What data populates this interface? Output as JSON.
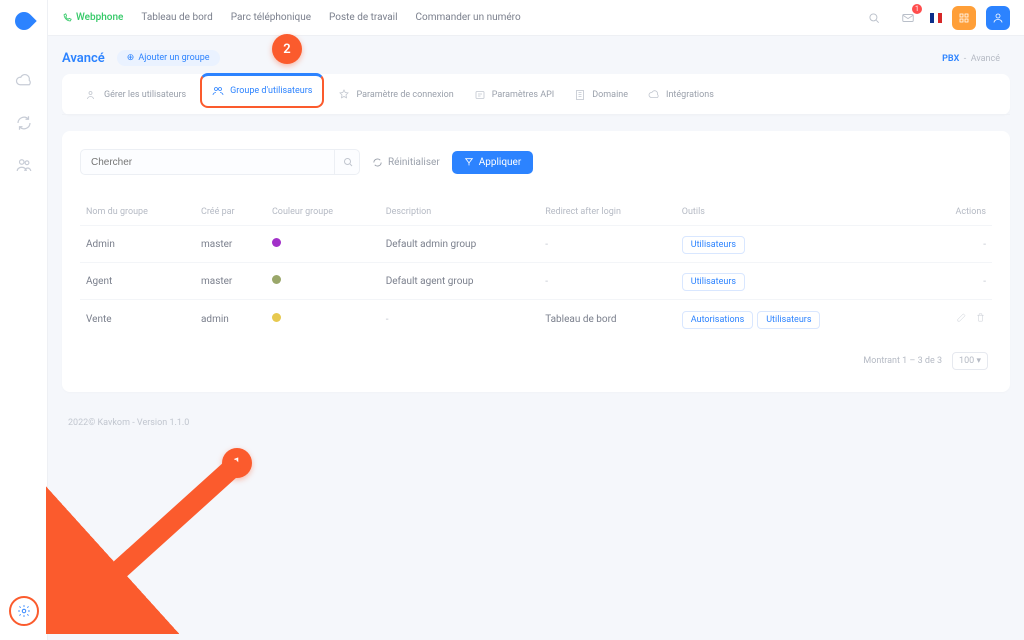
{
  "topnav": {
    "webphone": "Webphone",
    "items": [
      "Tableau de bord",
      "Parc téléphonique",
      "Poste de travail",
      "Commander un numéro"
    ],
    "notif_count": "1"
  },
  "page": {
    "title": "Avancé",
    "add_group": "Ajouter un groupe"
  },
  "breadcrumb": {
    "root": "PBX",
    "sep": "-",
    "current": "Avancé"
  },
  "tabs": {
    "manage_users": "Gérer les utilisateurs",
    "user_group": "Groupe d'utilisateurs",
    "login_param": "Paramètre de connexion",
    "api_params": "Paramètres API",
    "domain": "Domaine",
    "integrations": "Intégrations"
  },
  "controls": {
    "search_placeholder": "Chercher",
    "reset": "Réinitialiser",
    "apply": "Appliquer"
  },
  "columns": {
    "name": "Nom du groupe",
    "created_by": "Créé par",
    "color": "Couleur groupe",
    "description": "Description",
    "redirect": "Redirect after login",
    "tools": "Outils",
    "actions": "Actions"
  },
  "rows": [
    {
      "name": "Admin",
      "created_by": "master",
      "color": "#a231c9",
      "description": "Default admin group",
      "redirect": "-",
      "tools": [
        "Utilisateurs"
      ],
      "actions": "dash"
    },
    {
      "name": "Agent",
      "created_by": "master",
      "color": "#9aa76a",
      "description": "Default agent group",
      "redirect": "-",
      "tools": [
        "Utilisateurs"
      ],
      "actions": "dash"
    },
    {
      "name": "Vente",
      "created_by": "admin",
      "color": "#e7c94f",
      "description": "-",
      "redirect": "Tableau de bord",
      "tools": [
        "Autorisations",
        "Utilisateurs"
      ],
      "actions": "icons"
    }
  ],
  "buttons": {
    "users": "Utilisateurs",
    "perms": "Autorisations"
  },
  "pagination": {
    "showing": "Montrant 1 – 3 de 3",
    "size": "100"
  },
  "footer": "2022© Kavkom - Version 1.1.0",
  "annotations": {
    "one": "1",
    "two": "2"
  },
  "colors": {
    "primary": "#2c83ff",
    "accent": "#fb5b2d",
    "green": "#35c968"
  }
}
